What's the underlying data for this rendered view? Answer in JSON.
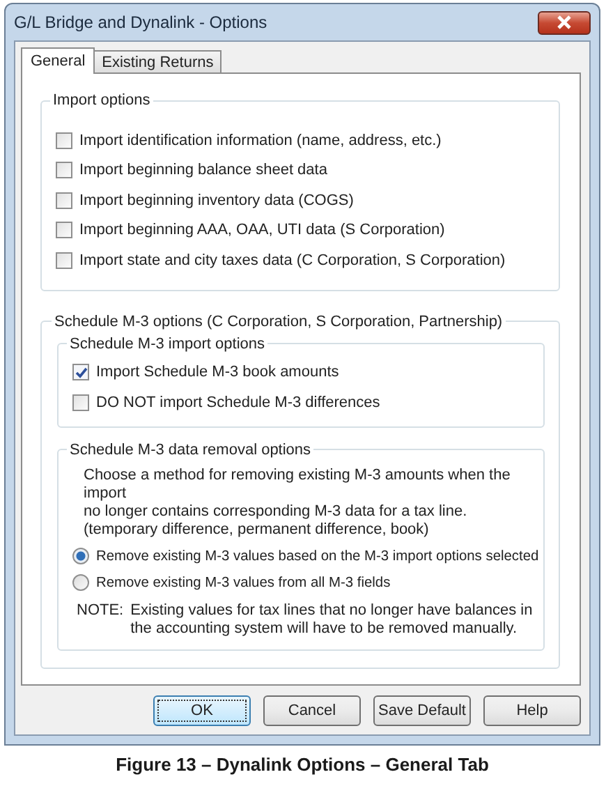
{
  "window": {
    "title": "G/L Bridge and Dynalink - Options"
  },
  "tabs": [
    {
      "label": "General",
      "selected": true
    },
    {
      "label": "Existing Returns",
      "selected": false
    }
  ],
  "import_options": {
    "title": "Import options",
    "items": [
      {
        "label": "Import identification information (name, address, etc.)",
        "checked": false
      },
      {
        "label": "Import beginning balance sheet data",
        "checked": false
      },
      {
        "label": "Import beginning inventory data (COGS)",
        "checked": false
      },
      {
        "label": "Import beginning AAA, OAA, UTI data (S Corporation)",
        "checked": false
      },
      {
        "label": "Import state and city taxes data (C Corporation, S Corporation)",
        "checked": false
      }
    ]
  },
  "m3_options": {
    "title": "Schedule M-3 options (C Corporation, S Corporation, Partnership)",
    "import_group": {
      "title": "Schedule M-3 import options",
      "items": [
        {
          "label": "Import Schedule M-3 book amounts",
          "checked": true
        },
        {
          "label": "DO NOT import Schedule M-3 differences",
          "checked": false
        }
      ]
    },
    "removal_group": {
      "title": "Schedule M-3 data removal options",
      "description": "Choose a method for removing existing M-3 amounts when the import\nno longer contains corresponding M-3 data for a tax line.\n(temporary difference, permanent difference, book)",
      "options": [
        {
          "label": "Remove existing M-3 values based on the M-3 import options selected",
          "selected": true
        },
        {
          "label": "Remove existing M-3 values from all M-3 fields",
          "selected": false
        }
      ],
      "note_label": "NOTE:",
      "note": "Existing values for tax lines that no longer have balances in\nthe accounting system will have to be removed manually."
    }
  },
  "buttons": [
    {
      "label": "OK",
      "default": true
    },
    {
      "label": "Cancel",
      "default": false
    },
    {
      "label": "Save Default",
      "default": false
    },
    {
      "label": "Help",
      "default": false
    }
  ],
  "caption": "Figure 13 – Dynalink Options – General Tab"
}
